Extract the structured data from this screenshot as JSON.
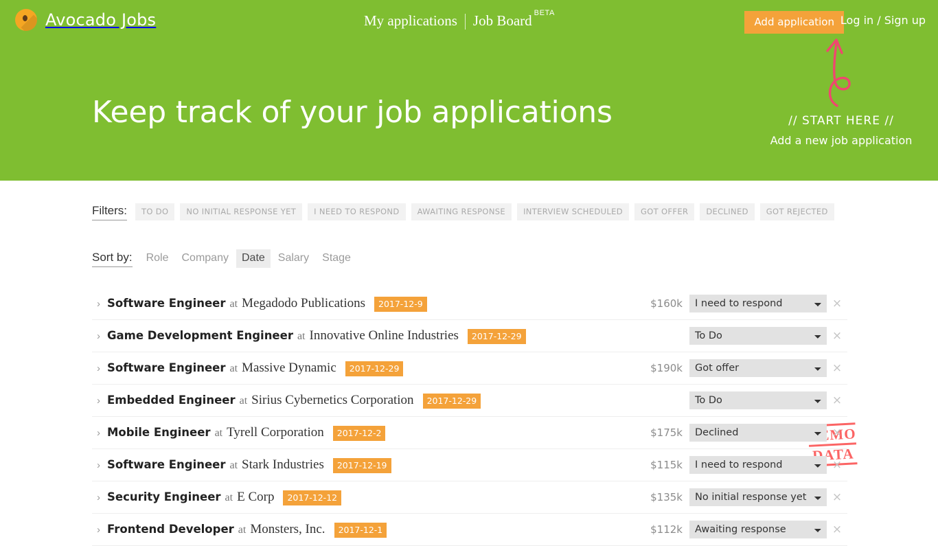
{
  "brand": {
    "name": "Avocado Jobs",
    "logo_icon": "avocado-icon"
  },
  "topnav": {
    "my_applications": "My applications",
    "job_board": "Job Board",
    "beta_badge": "BETA"
  },
  "header": {
    "add_application": "Add application",
    "login_signup": "Log in / Sign up"
  },
  "hero": {
    "title": "Keep track of your job applications",
    "annotation_title": "// START HERE //",
    "annotation_subtitle": "Add a new job application",
    "arrow_icon": "curly-arrow-up-icon",
    "bg_color": "#7fbe31",
    "accent_color": "#f4a23a",
    "annotation_color": "#ef476f"
  },
  "filters": {
    "label": "Filters:",
    "chips": [
      "TO DO",
      "NO INITIAL RESPONSE YET",
      "I NEED TO RESPOND",
      "AWAITING RESPONSE",
      "INTERVIEW SCHEDULED",
      "GOT OFFER",
      "DECLINED",
      "GOT REJECTED"
    ]
  },
  "sort": {
    "label": "Sort by:",
    "options": [
      "Role",
      "Company",
      "Date",
      "Salary",
      "Stage"
    ],
    "active": "Date"
  },
  "demo_stamp": {
    "line1": "DEMO",
    "line2": "DATA",
    "color": "#fb6464"
  },
  "status_options": [
    "To Do",
    "No initial response yet",
    "I need to respond",
    "Awaiting response",
    "Interview scheduled",
    "Got offer",
    "Declined",
    "Got rejected"
  ],
  "jobs": [
    {
      "expand_icon": "chevron-right-icon",
      "role": "Software Engineer",
      "at": "at",
      "company": "Megadodo Publications",
      "date": "2017-12-9",
      "salary": "$160k",
      "status": "I need to respond",
      "remove_icon": "close-icon"
    },
    {
      "expand_icon": "chevron-right-icon",
      "role": "Game Development Engineer",
      "at": "at",
      "company": "Innovative Online Industries",
      "date": "2017-12-29",
      "salary": "",
      "status": "To Do",
      "remove_icon": "close-icon"
    },
    {
      "expand_icon": "chevron-right-icon",
      "role": "Software Engineer",
      "at": "at",
      "company": "Massive Dynamic",
      "date": "2017-12-29",
      "salary": "$190k",
      "status": "Got offer",
      "remove_icon": "close-icon"
    },
    {
      "expand_icon": "chevron-right-icon",
      "role": "Embedded Engineer",
      "at": "at",
      "company": "Sirius Cybernetics Corporation",
      "date": "2017-12-29",
      "salary": "",
      "status": "To Do",
      "remove_icon": "close-icon"
    },
    {
      "expand_icon": "chevron-right-icon",
      "role": "Mobile Engineer",
      "at": "at",
      "company": "Tyrell Corporation",
      "date": "2017-12-2",
      "salary": "$175k",
      "status": "Declined",
      "remove_icon": "close-icon"
    },
    {
      "expand_icon": "chevron-right-icon",
      "role": "Software Engineer",
      "at": "at",
      "company": "Stark Industries",
      "date": "2017-12-19",
      "salary": "$115k",
      "status": "I need to respond",
      "remove_icon": "close-icon"
    },
    {
      "expand_icon": "chevron-right-icon",
      "role": "Security Engineer",
      "at": "at",
      "company": "E Corp",
      "date": "2017-12-12",
      "salary": "$135k",
      "status": "No initial response yet",
      "remove_icon": "close-icon"
    },
    {
      "expand_icon": "chevron-right-icon",
      "role": "Frontend Developer",
      "at": "at",
      "company": "Monsters, Inc.",
      "date": "2017-12-1",
      "salary": "$112k",
      "status": "Awaiting response",
      "remove_icon": "close-icon"
    }
  ]
}
